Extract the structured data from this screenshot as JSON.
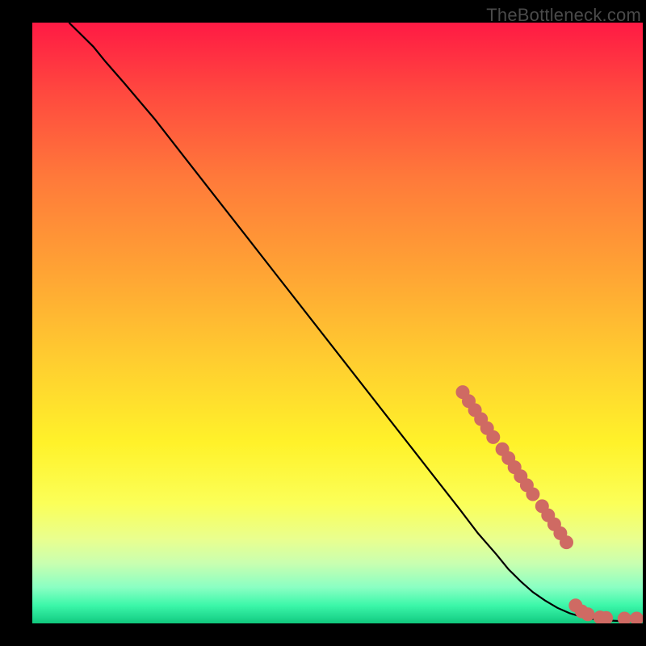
{
  "watermark": "TheBottleneck.com",
  "colors": {
    "page_bg": "#000000",
    "marker": "#cf6a63",
    "curve": "#000000",
    "gradient_stops": [
      "#ff1a44",
      "#ff4a3f",
      "#ff7a3a",
      "#ffa534",
      "#ffd22f",
      "#fff22a",
      "#fbff58",
      "#e9ff8f",
      "#c9ffb0",
      "#8affc3",
      "#3cf7a9",
      "#1fd98f",
      "#10c67b"
    ]
  },
  "chart_data": {
    "type": "line",
    "title": "",
    "xlabel": "",
    "ylabel": "",
    "xlim": [
      0,
      100
    ],
    "ylim": [
      0,
      100
    ],
    "grid": false,
    "legend": false,
    "series": [
      {
        "name": "curve",
        "x": [
          6,
          8,
          10,
          12,
          15,
          20,
          25,
          30,
          35,
          40,
          45,
          50,
          55,
          60,
          65,
          70,
          73,
          76,
          78,
          80,
          82,
          84,
          86,
          88,
          90,
          92,
          94,
          96,
          98,
          100
        ],
        "y": [
          100,
          98,
          96,
          93.5,
          90,
          84,
          77.5,
          71,
          64.5,
          58,
          51.5,
          45,
          38.5,
          32,
          25.5,
          19,
          15,
          11.5,
          9,
          7,
          5.2,
          3.8,
          2.6,
          1.7,
          1.1,
          0.7,
          0.5,
          0.4,
          0.4,
          0.4
        ]
      }
    ],
    "markers": [
      {
        "x": 70.5,
        "y": 38.5
      },
      {
        "x": 71.5,
        "y": 37.0
      },
      {
        "x": 72.5,
        "y": 35.5
      },
      {
        "x": 73.5,
        "y": 34.0
      },
      {
        "x": 74.5,
        "y": 32.5
      },
      {
        "x": 75.5,
        "y": 31.0
      },
      {
        "x": 77.0,
        "y": 29.0
      },
      {
        "x": 78.0,
        "y": 27.5
      },
      {
        "x": 79.0,
        "y": 26.0
      },
      {
        "x": 80.0,
        "y": 24.5
      },
      {
        "x": 81.0,
        "y": 23.0
      },
      {
        "x": 82.0,
        "y": 21.5
      },
      {
        "x": 83.5,
        "y": 19.5
      },
      {
        "x": 84.5,
        "y": 18.0
      },
      {
        "x": 85.5,
        "y": 16.5
      },
      {
        "x": 86.5,
        "y": 15.0
      },
      {
        "x": 87.5,
        "y": 13.5
      },
      {
        "x": 89.0,
        "y": 3.0
      },
      {
        "x": 90.0,
        "y": 2.0
      },
      {
        "x": 91.0,
        "y": 1.5
      },
      {
        "x": 93.0,
        "y": 1.0
      },
      {
        "x": 94.0,
        "y": 0.9
      },
      {
        "x": 97.0,
        "y": 0.8
      },
      {
        "x": 99.0,
        "y": 0.8
      }
    ]
  }
}
